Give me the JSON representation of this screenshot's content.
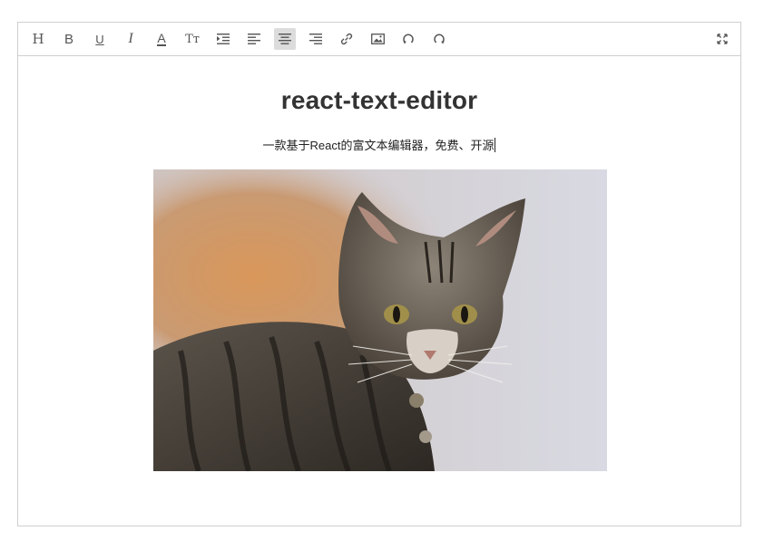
{
  "toolbar": {
    "buttons": [
      {
        "name": "heading-icon",
        "glyph": "H"
      },
      {
        "name": "bold-icon",
        "glyph": "B"
      },
      {
        "name": "underline-icon",
        "glyph": "U"
      },
      {
        "name": "italic-icon",
        "glyph": "I"
      },
      {
        "name": "font-color-icon",
        "glyph": "A"
      },
      {
        "name": "font-size-icon",
        "glyph": "Tт"
      },
      {
        "name": "indent-icon"
      },
      {
        "name": "align-left-icon"
      },
      {
        "name": "align-center-icon",
        "active": true
      },
      {
        "name": "align-right-icon"
      },
      {
        "name": "link-icon"
      },
      {
        "name": "image-icon"
      },
      {
        "name": "undo-icon"
      },
      {
        "name": "redo-icon"
      },
      {
        "name": "fullscreen-icon"
      }
    ],
    "active_color": "#dcdcdc"
  },
  "document": {
    "title": "react-text-editor",
    "subtitle": "一款基于React的富文本编辑器，免费、开源"
  },
  "colors": {
    "border": "#cfcfcf",
    "icon": "#555555",
    "text": "#333333"
  }
}
